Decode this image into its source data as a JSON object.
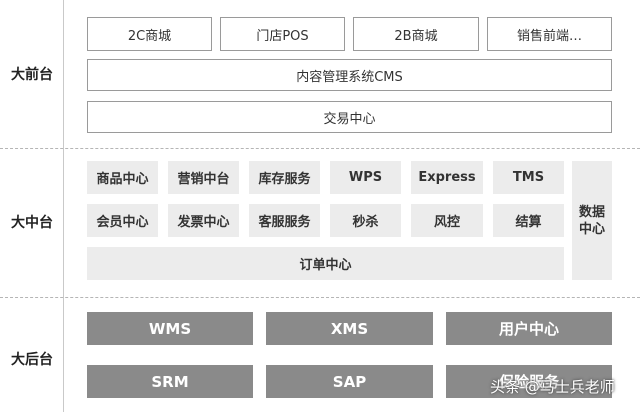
{
  "rows": {
    "front": {
      "label": "大前台"
    },
    "middle": {
      "label": "大中台"
    },
    "back": {
      "label": "大后台"
    }
  },
  "front": {
    "channels": [
      "2C商城",
      "门店POS",
      "2B商城",
      "销售前端…"
    ],
    "cms": "内容管理系统CMS",
    "trade": "交易中心"
  },
  "middle": {
    "row1": [
      "商品中心",
      "营销中台",
      "库存服务",
      "WPS",
      "Express",
      "TMS"
    ],
    "row2": [
      "会员中心",
      "发票中心",
      "客服服务",
      "秒杀",
      "风控",
      "结算"
    ],
    "order": "订单中心",
    "data_center": "数据\n中心"
  },
  "back": {
    "row1": [
      "WMS",
      "XMS",
      "用户中心"
    ],
    "row2": [
      "SRM",
      "SAP",
      "保险服务"
    ]
  },
  "watermark": "头条 @马士兵老师"
}
